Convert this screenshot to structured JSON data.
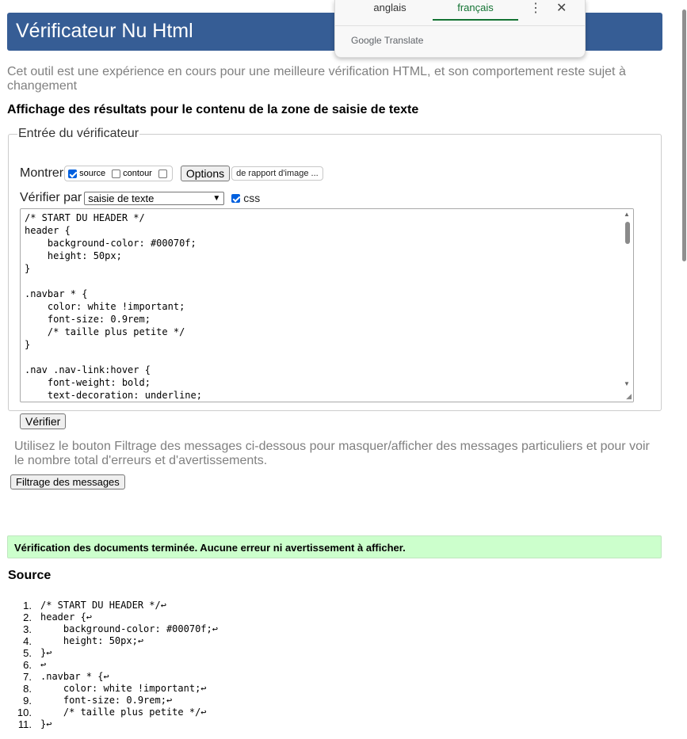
{
  "header": {
    "title": "Vérificateur Nu Html"
  },
  "intro": "Cet outil est une expérience en cours pour une meilleure vérification HTML, et son comportement reste sujet à changement",
  "subtitle": "Affichage des résultats pour le contenu de la zone de saisie de texte",
  "checker": {
    "legend": "Entrée du vérificateur",
    "show_label": "Montrer",
    "source_label": "source",
    "outline_label": "contour",
    "options_label": "Options",
    "report_label": "de rapport d'image ...",
    "check_by_label": "Vérifier par",
    "select_value": "saisie de texte",
    "css_label": "css",
    "textarea": "/* START DU HEADER */\nheader {\n    background-color: #00070f;\n    height: 50px;\n}\n\n.navbar * {\n    color: white !important;\n    font-size: 0.9rem;\n    /* taille plus petite */\n}\n\n.nav .nav-link:hover {\n    font-weight: bold;\n    text-decoration: underline;",
    "verify_label": "Vérifier"
  },
  "filter": {
    "note": "Utilisez le bouton Filtrage des messages ci-dessous pour masquer/afficher des messages particuliers et pour voir le nombre total d'erreurs et d'avertissements.",
    "button": "Filtrage des messages"
  },
  "result": {
    "success": "Vérification des documents terminée. Aucune erreur ni avertissement à afficher."
  },
  "source": {
    "heading": "Source",
    "lines": [
      {
        "num": "1.",
        "code": "/* START DU HEADER */↩"
      },
      {
        "num": "2.",
        "code": "header {↩"
      },
      {
        "num": "3.",
        "code": "    background-color: #00070f;↩"
      },
      {
        "num": "4.",
        "code": "    height: 50px;↩"
      },
      {
        "num": "5.",
        "code": "}↩"
      },
      {
        "num": "6.",
        "code": "↩"
      },
      {
        "num": "7.",
        "code": ".navbar * {↩"
      },
      {
        "num": "8.",
        "code": "    color: white !important;↩"
      },
      {
        "num": "9.",
        "code": "    font-size: 0.9rem;↩"
      },
      {
        "num": "10.",
        "code": "    /* taille plus petite */↩"
      },
      {
        "num": "11.",
        "code": "}↩"
      }
    ]
  },
  "translate": {
    "tab_en": "anglais",
    "tab_fr": "français",
    "brand": "Google Translate",
    "more_icon": "⋮",
    "close_icon": "✕"
  }
}
